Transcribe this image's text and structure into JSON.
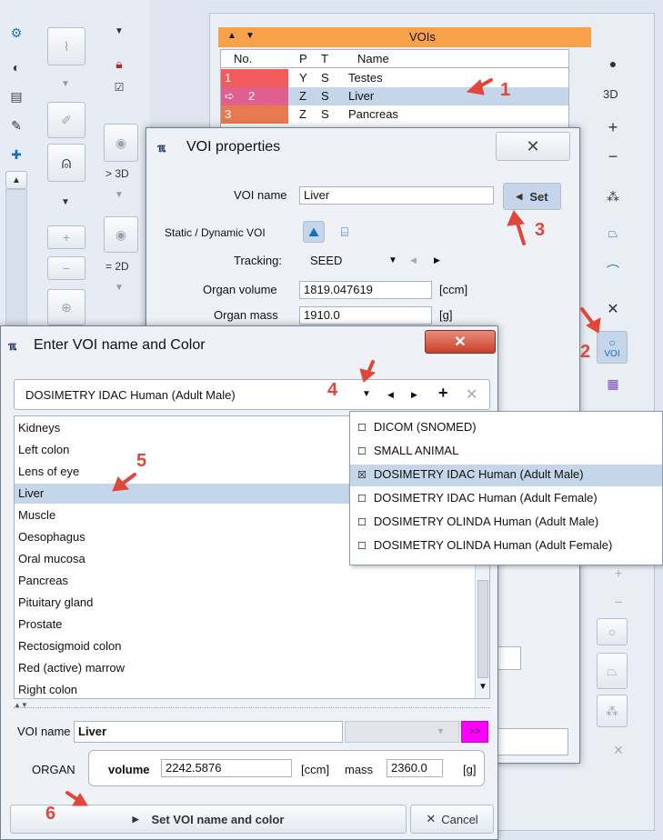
{
  "side_labels": {
    "to3d": "> 3D",
    "to2d": "= 2D"
  },
  "voi_panel": {
    "header": "VOIs",
    "columns": [
      "No.",
      "P",
      "T",
      "Name"
    ],
    "rows": [
      {
        "no": "1",
        "p": "Y",
        "t": "S",
        "name": "Testes",
        "color": "#f25c5c"
      },
      {
        "no": "2",
        "p": "Z",
        "t": "S",
        "name": "Liver",
        "color": "#e05f8f"
      },
      {
        "no": "3",
        "p": "Z",
        "t": "S",
        "name": "Pancreas",
        "color": "#e87a52"
      }
    ]
  },
  "right_toolbar": {
    "btn_3d": "3D",
    "btn_voi": "VOI"
  },
  "voi_props": {
    "title": "VOI properties",
    "voi_name_label": "VOI name",
    "voi_name_value": "Liver",
    "set_button": "Set",
    "static_dynamic_label": "Static / Dynamic VOI",
    "tracking_label": "Tracking:",
    "tracking_value": "SEED",
    "organ_volume_label": "Organ volume",
    "organ_volume_value": "1819.047619",
    "organ_volume_unit": "[ccm]",
    "organ_mass_label": "Organ mass",
    "organ_mass_value": "1910.0",
    "organ_mass_unit": "[g]"
  },
  "enter_dialog": {
    "title": "Enter VOI name and Color",
    "atlas_selected": "DOSIMETRY IDAC Human (Adult Male)",
    "list_items": [
      "Kidneys",
      "Left colon",
      "Lens of eye",
      "Liver",
      "Muscle",
      "Oesophagus",
      "Oral mucosa",
      "Pancreas",
      "Pituitary gland",
      "Prostate",
      "Rectosigmoid colon",
      "Red (active) marrow",
      "Right colon"
    ],
    "selected_item": "Liver",
    "voi_name_label": "VOI name",
    "voi_name_value": "Liver",
    "color_button": ">>",
    "organ_label": "ORGAN",
    "volume_label": "volume",
    "volume_value": "2242.5876",
    "volume_unit": "[ccm]",
    "mass_label": "mass",
    "mass_value": "2360.0",
    "mass_unit": "[g]",
    "set_button": "Set VOI name and color",
    "cancel_button": "Cancel"
  },
  "atlas_dropdown": {
    "options": [
      "DICOM (SNOMED)",
      "SMALL ANIMAL",
      "DOSIMETRY IDAC Human (Adult Male)",
      "DOSIMETRY IDAC Human (Adult Female)",
      "DOSIMETRY OLINDA Human (Adult Male)",
      "DOSIMETRY OLINDA Human (Adult Female)"
    ],
    "checked_index": 2
  },
  "annotations": [
    "1",
    "2",
    "3",
    "4",
    "5",
    "6"
  ],
  "colors": {
    "accent_orange": "#f7a24a",
    "selection_blue": "#c5d5ea",
    "annotation_red": "#e2463a",
    "color_swatch_magenta": "#ff00ff"
  }
}
